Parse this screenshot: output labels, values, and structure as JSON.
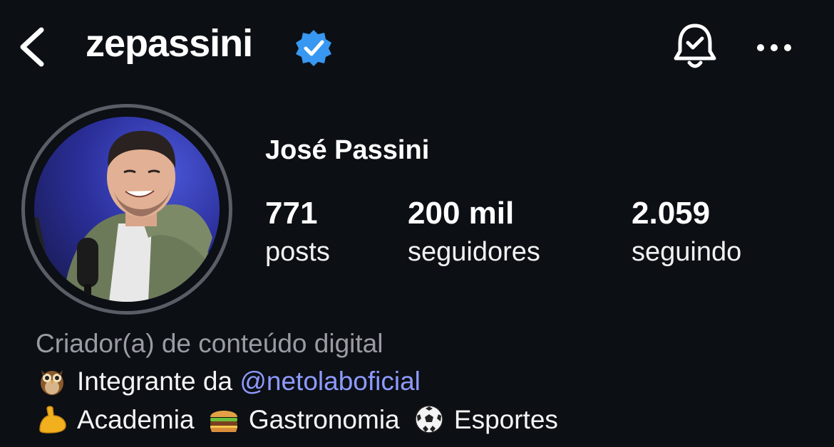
{
  "header": {
    "username": "zepassini",
    "verified_icon": "verified-badge-icon",
    "bell_icon": "bell-check-icon",
    "more_icon": "more-horizontal-icon"
  },
  "profile": {
    "full_name": "José Passini",
    "stats": {
      "posts_count": "771",
      "posts_label": "posts",
      "followers_count": "200 mil",
      "followers_label": "seguidores",
      "following_count": "2.059",
      "following_label": "seguindo"
    },
    "category": "Criador(a) de conteúdo digital",
    "bio": {
      "line1_prefix": "Integrante da ",
      "line1_mention": "@netolaboficial",
      "line2_items": [
        "Academia",
        "Gastronomia",
        "Esportes"
      ]
    }
  },
  "colors": {
    "background": "#0c0f14",
    "verified_blue": "#3897f0",
    "mention": "#8e9bff",
    "category_gray": "#9a9ca3"
  }
}
